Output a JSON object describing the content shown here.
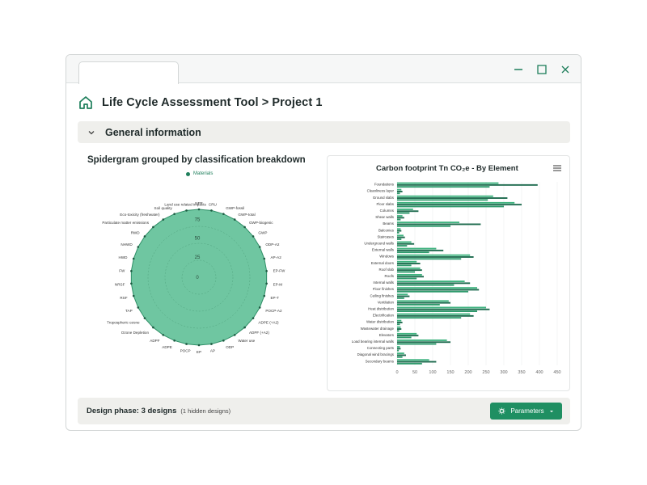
{
  "window": {
    "controls": {
      "minimize_icon": "minimize-icon",
      "maximize_icon": "maximize-icon",
      "close_icon": "close-icon"
    }
  },
  "header": {
    "title": "Life Cycle Assessment Tool > Project 1",
    "icon": "home-icon"
  },
  "section": {
    "title": "General information",
    "icon": "chevron-down-icon"
  },
  "spider": {
    "title": "Spidergram grouped by classification breakdown",
    "legend": "Materials",
    "radial_ticks": [
      "75",
      "50",
      "25",
      "0"
    ],
    "axes": [
      "NFR",
      "CRU",
      "GWP-fossil",
      "GWP-total",
      "GWP-biogenic",
      "GWP",
      "ODP-A2",
      "AP-A2",
      "EP-FW",
      "EP-M",
      "EP-T",
      "POCP-A2",
      "ADPE (+A2)",
      "ADPF (+A2)",
      "Water use",
      "ODP",
      "AP",
      "EP",
      "POCP",
      "ADPE",
      "ADPF",
      "Ozone Depletion",
      "Tropospheric ozone",
      "TAP",
      "RSF",
      "NRSF",
      "FW",
      "HWD",
      "NHWD",
      "RWD",
      "Particulate matter emissions",
      "Eco-toxicity (freshwater)",
      "Soil quality",
      "Land use related impacts"
    ],
    "colors": {
      "fill": "#6fc6a1",
      "stroke": "#2f8f67",
      "grid": "#4a9a76"
    }
  },
  "chart_data": {
    "type": "bar",
    "title": "Carbon footprint Tn CO₂e - By Element",
    "orientation": "horizontal",
    "xlim": [
      0,
      450
    ],
    "xticks": [
      "0",
      "50",
      "100",
      "150",
      "200",
      "250",
      "300",
      "350",
      "400",
      "450"
    ],
    "categories": [
      "Foundations",
      "Cleanliness layer",
      "Ground slabs",
      "Floor slabs",
      "Columns",
      "Shear walls",
      "Beams",
      "Balconies",
      "Staircases",
      "Underground walls",
      "External walls",
      "Windows",
      "External doors",
      "Roof slab",
      "Roofs",
      "Internal walls",
      "Floor finishes",
      "Ceiling finishes",
      "Ventilation",
      "Heat distribution",
      "Electrification",
      "Water distribution",
      "Wastewater drainage",
      "Elevators",
      "Load bearing internal walls",
      "Connecting parts",
      "Diagonal wind bracings",
      "Secondary beams"
    ],
    "series": [
      {
        "values": [
          285,
          12,
          270,
          330,
          45,
          15,
          175,
          10,
          18,
          40,
          110,
          205,
          55,
          65,
          70,
          190,
          225,
          30,
          145,
          250,
          205,
          12,
          10,
          55,
          140,
          8,
          20,
          90
        ]
      },
      {
        "values": [
          395,
          15,
          310,
          350,
          60,
          20,
          235,
          12,
          22,
          48,
          130,
          215,
          65,
          70,
          75,
          205,
          230,
          35,
          150,
          260,
          215,
          15,
          12,
          60,
          150,
          10,
          25,
          110
        ]
      },
      {
        "values": [
          260,
          8,
          255,
          300,
          35,
          10,
          150,
          6,
          12,
          28,
          90,
          180,
          40,
          50,
          55,
          160,
          200,
          20,
          120,
          225,
          180,
          8,
          6,
          40,
          110,
          5,
          15,
          70
        ]
      }
    ],
    "colors": [
      "#3fb37f",
      "#1f6b4f",
      "#2e9a6c"
    ]
  },
  "footer": {
    "phase_label": "Design phase: 3 designs",
    "phase_note": "(1 hidden designs)",
    "button_label": "Parameters"
  }
}
